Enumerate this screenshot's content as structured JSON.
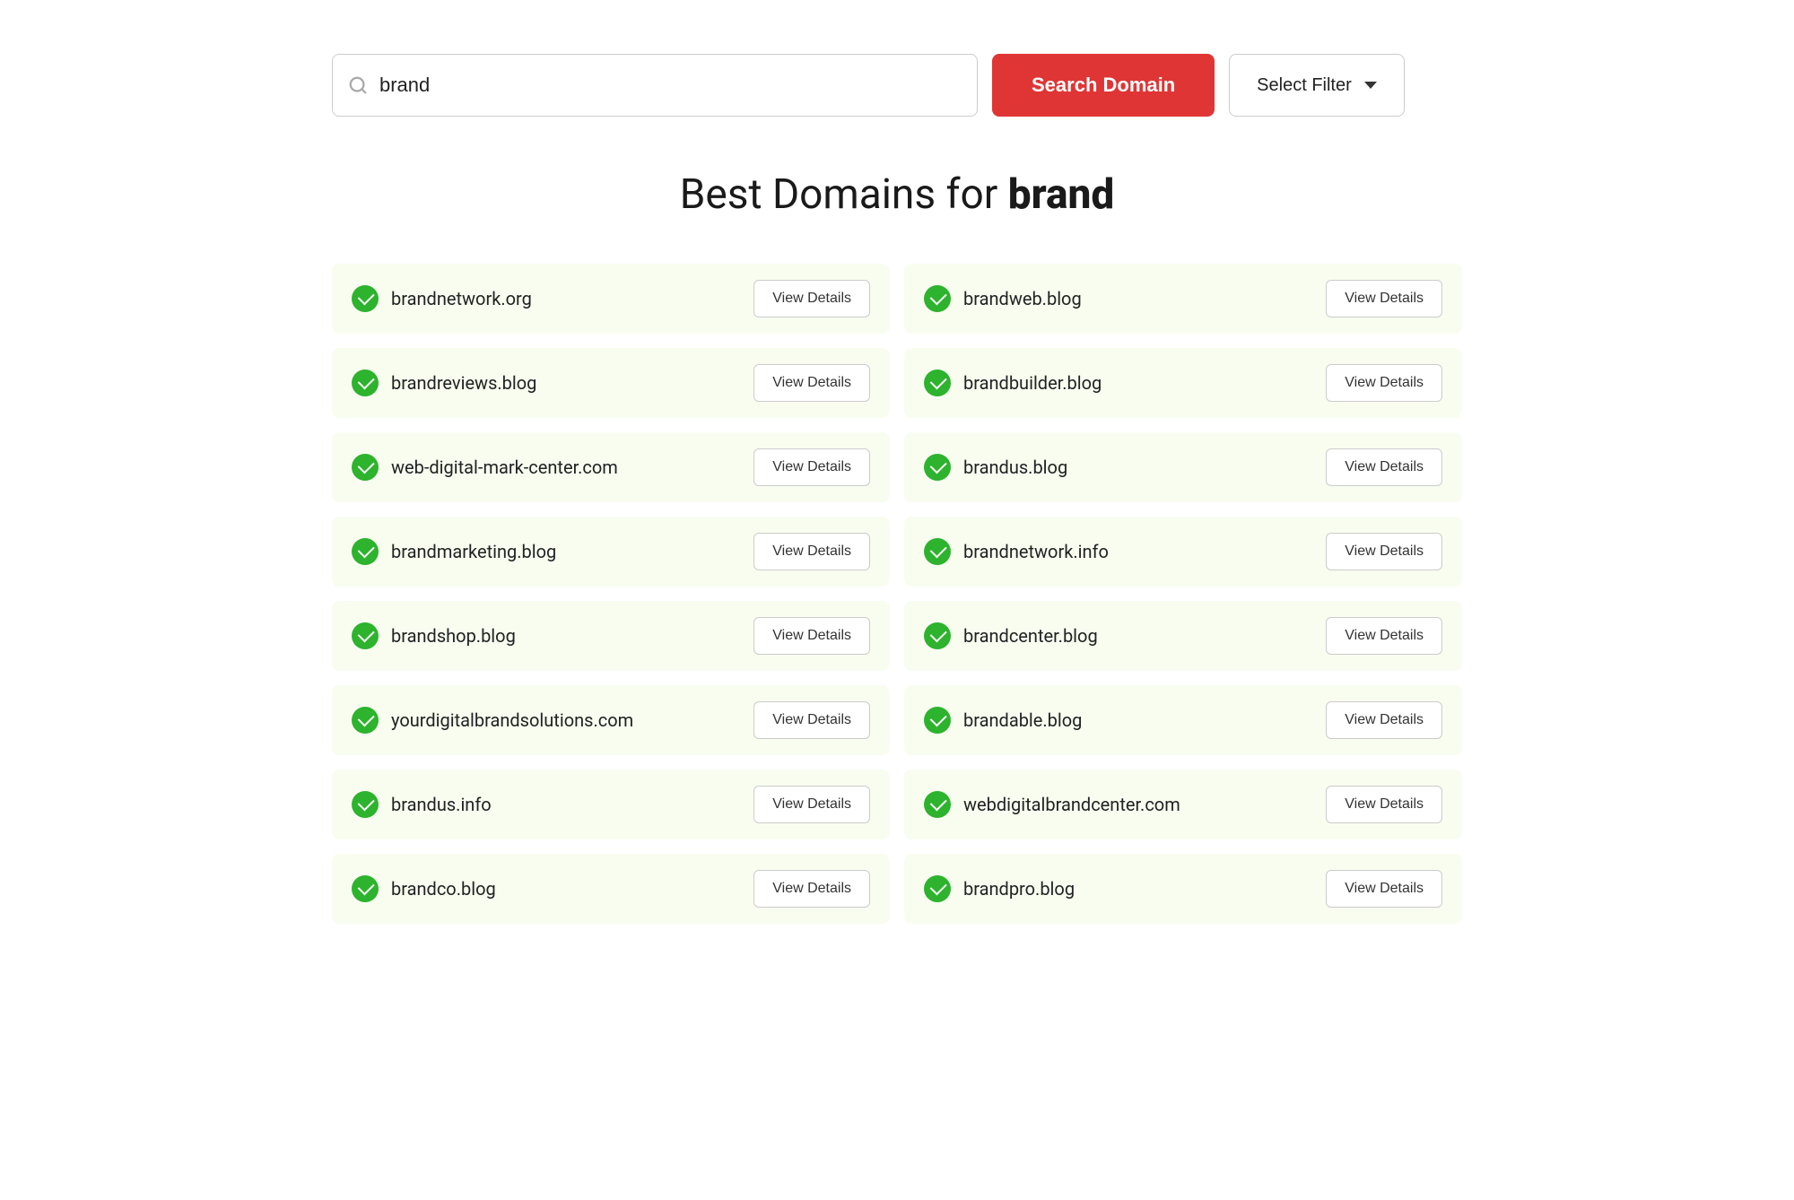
{
  "search": {
    "placeholder": "brand",
    "current_value": "brand",
    "search_button_label": "Search Domain",
    "filter_button_label": "Select Filter"
  },
  "page": {
    "title_prefix": "Best Domains for ",
    "title_keyword": "brand"
  },
  "domains": [
    {
      "id": 1,
      "name": "brandnetwork.org",
      "col": "left"
    },
    {
      "id": 2,
      "name": "brandweb.blog",
      "col": "right"
    },
    {
      "id": 3,
      "name": "brandreviews.blog",
      "col": "left"
    },
    {
      "id": 4,
      "name": "brandbuilder.blog",
      "col": "right"
    },
    {
      "id": 5,
      "name": "web-digital-mark-center.com",
      "col": "left"
    },
    {
      "id": 6,
      "name": "brandus.blog",
      "col": "right"
    },
    {
      "id": 7,
      "name": "brandmarketing.blog",
      "col": "left"
    },
    {
      "id": 8,
      "name": "brandnetwork.info",
      "col": "right"
    },
    {
      "id": 9,
      "name": "brandshop.blog",
      "col": "left"
    },
    {
      "id": 10,
      "name": "brandcenter.blog",
      "col": "right"
    },
    {
      "id": 11,
      "name": "yourdigitalbrandsolutions.com",
      "col": "left"
    },
    {
      "id": 12,
      "name": "brandable.blog",
      "col": "right"
    },
    {
      "id": 13,
      "name": "brandus.info",
      "col": "left"
    },
    {
      "id": 14,
      "name": "webdigitalbrandcenter.com",
      "col": "right"
    },
    {
      "id": 15,
      "name": "brandco.blog",
      "col": "left"
    },
    {
      "id": 16,
      "name": "brandpro.blog",
      "col": "right"
    }
  ],
  "view_details_label": "View Details",
  "colors": {
    "search_button_bg": "#e03535",
    "check_green": "#2db32d",
    "domain_bg": "#f8fdf0"
  }
}
